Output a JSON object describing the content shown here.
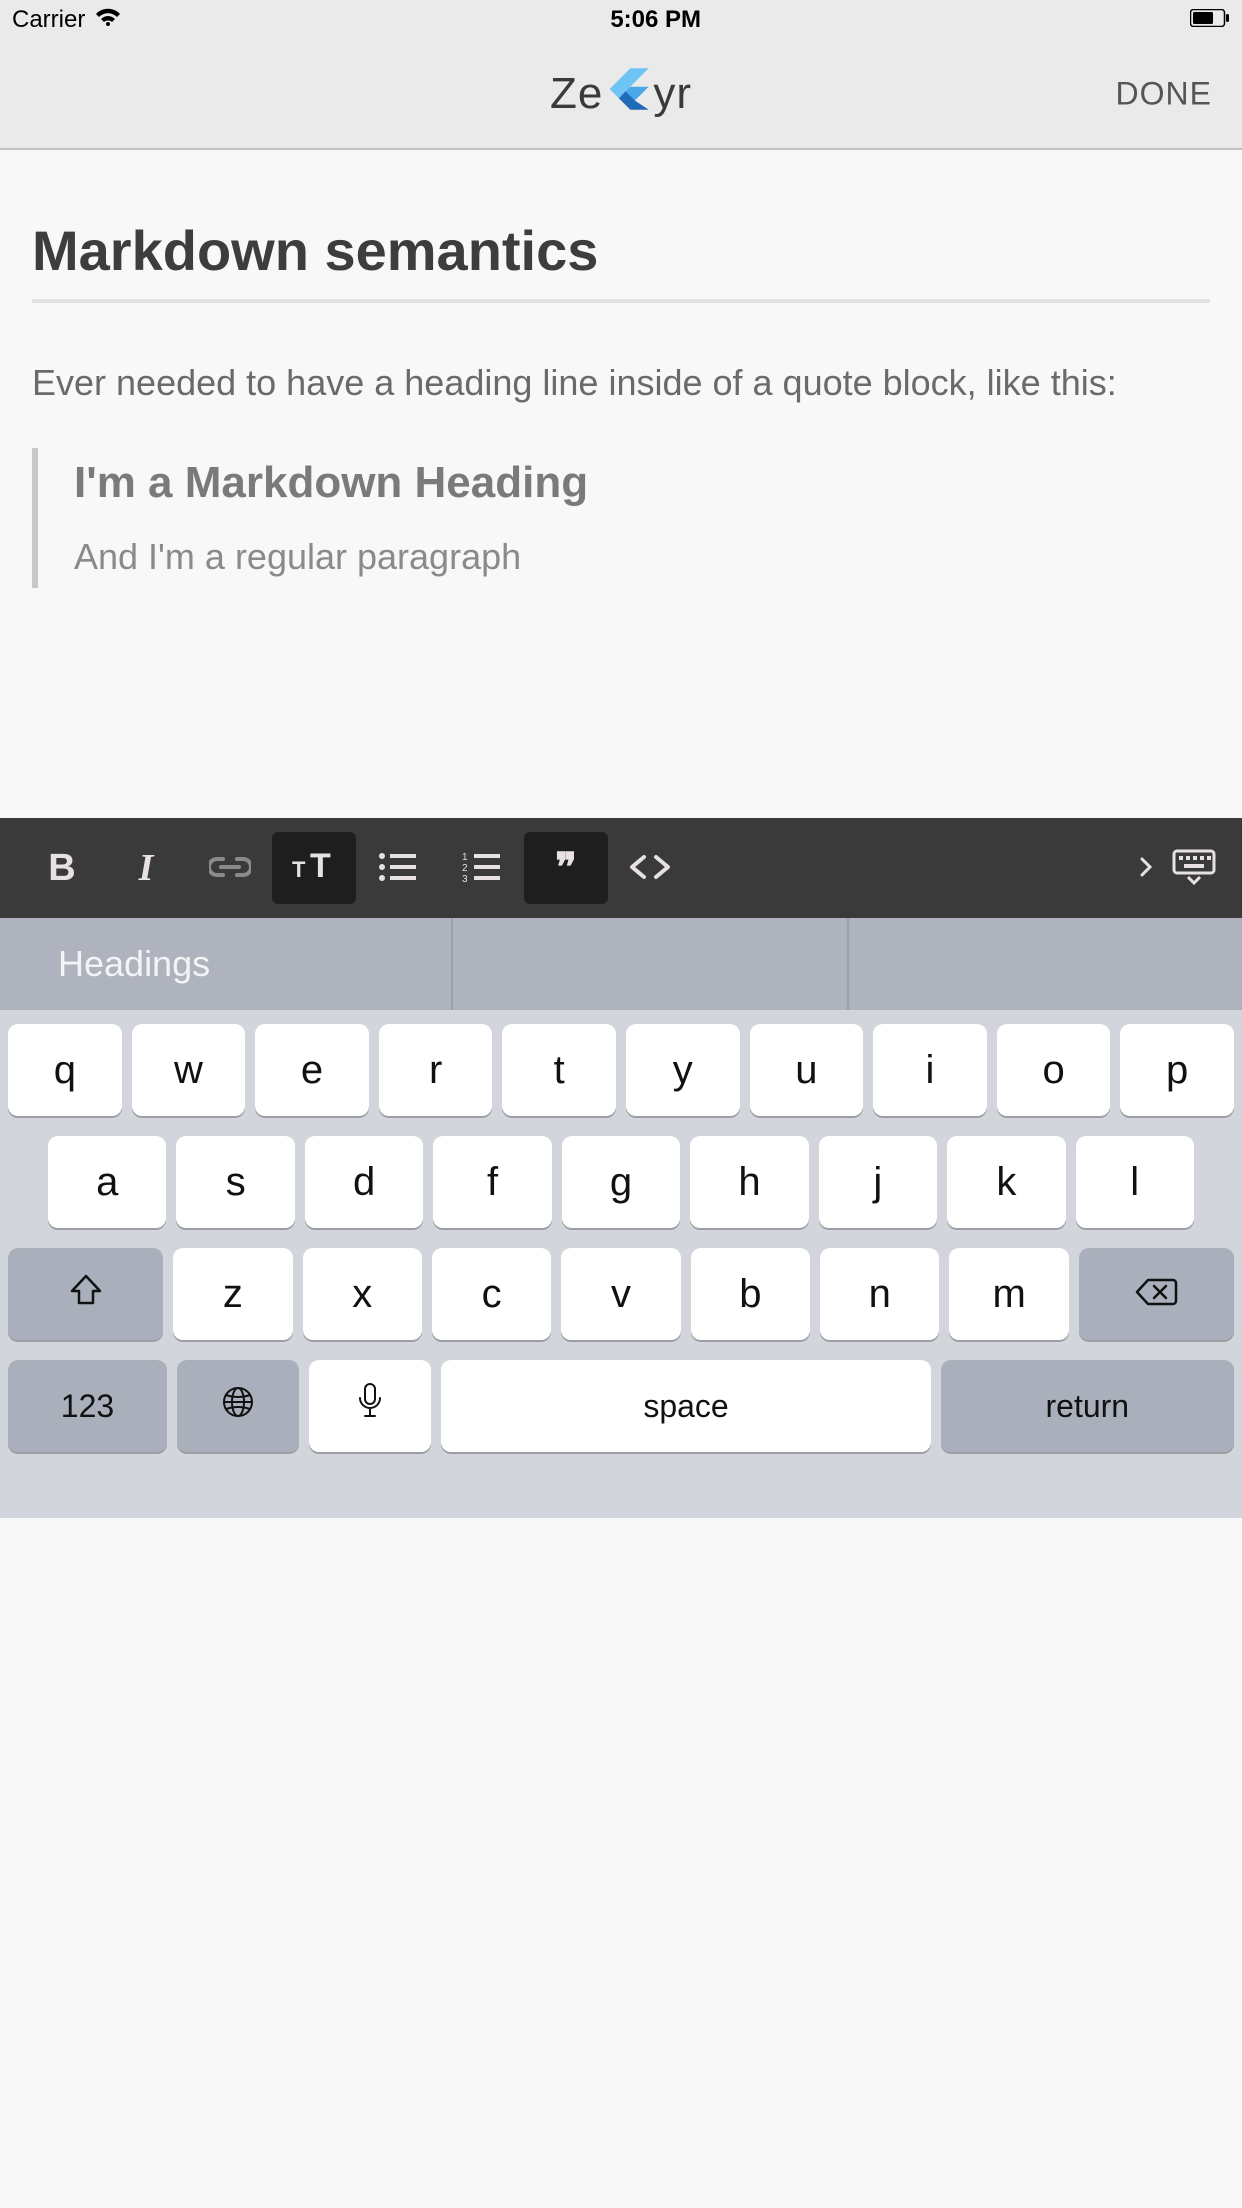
{
  "status": {
    "carrier": "Carrier",
    "time": "5:06 PM"
  },
  "header": {
    "title_prefix": "Ze",
    "title_suffix": "yr",
    "done_label": "DONE"
  },
  "document": {
    "heading": "Markdown semantics",
    "intro": "Ever needed to have a heading line inside of a quote block, like this:",
    "quote": {
      "heading": "I'm a Markdown Heading",
      "paragraph": "And I'm a regular paragraph"
    }
  },
  "toolbar": {
    "buttons": {
      "bold": "B",
      "italic": "I",
      "link": "link",
      "text_style": "text-style",
      "ul": "bulleted-list",
      "ol": "numbered-list",
      "quote": "quote",
      "code": "code",
      "expand": "expand",
      "hide_keyboard": "hide-keyboard"
    },
    "active": [
      "text_style",
      "quote"
    ]
  },
  "suggestions": {
    "items": [
      "Headings",
      "",
      ""
    ]
  },
  "keyboard": {
    "row1": [
      "q",
      "w",
      "e",
      "r",
      "t",
      "y",
      "u",
      "i",
      "o",
      "p"
    ],
    "row2": [
      "a",
      "s",
      "d",
      "f",
      "g",
      "h",
      "j",
      "k",
      "l"
    ],
    "row3": [
      "z",
      "x",
      "c",
      "v",
      "b",
      "n",
      "m"
    ],
    "num_label": "123",
    "space_label": "space",
    "return_label": "return"
  }
}
